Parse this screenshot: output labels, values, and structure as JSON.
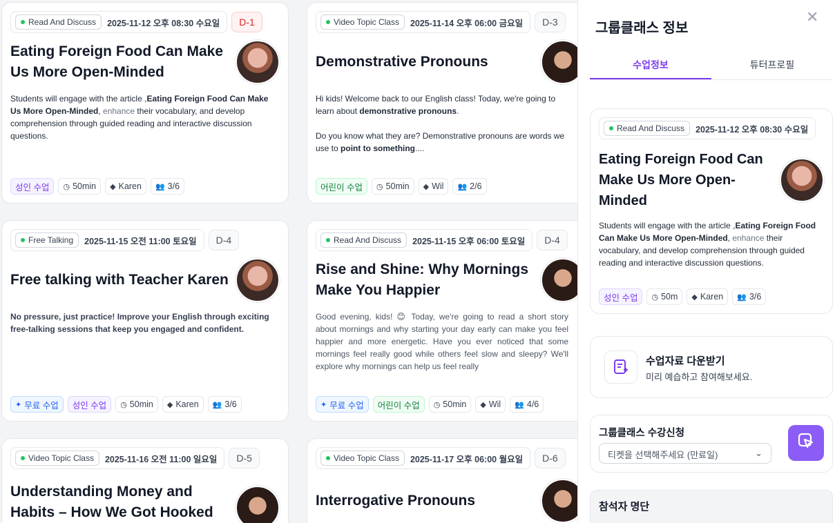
{
  "cards": [
    {
      "category": "Read And Discuss",
      "date": "2025-11-12 오후 08:30 수요일",
      "dday": "D-1",
      "title": "Eating Foreign Food Can Make Us More Open-Minded",
      "desc_1": "Students will engage with the article ,",
      "desc_bold": "Eating Foreign Food Can Make Us More Open-Minded",
      "desc_2": ", ",
      "desc_muted": "enhance",
      "desc_3": " their vocabulary, and develop comprehension through guided reading and interactive discussion questions.",
      "tags": [
        {
          "label": "성인 수업",
          "kind": "adult"
        },
        {
          "label": "50min",
          "kind": "time"
        },
        {
          "label": "Karen",
          "kind": "tutor"
        },
        {
          "label": "3/6",
          "kind": "people"
        }
      ]
    },
    {
      "category": "Video Topic Class",
      "date": "2025-11-14 오후 06:00 금요일",
      "dday": "D-3",
      "title": "Demonstrative Pronouns",
      "desc_p1_a": "Hi kids! Welcome back to our English class! Today, we're going to learn about ",
      "desc_p1_b": "demonstrative pronouns",
      "desc_p1_c": ".",
      "desc_p2_a": "Do you know what they are? Demonstrative pronouns are words we use to ",
      "desc_p2_b": "point to something",
      "desc_p2_c": "....",
      "tags": [
        {
          "label": "어린이 수업",
          "kind": "kid"
        },
        {
          "label": "50min",
          "kind": "time"
        },
        {
          "label": "Wil",
          "kind": "tutor"
        },
        {
          "label": "2/6",
          "kind": "people"
        }
      ]
    },
    {
      "category": "Free Talking",
      "date": "2025-11-15 오전 11:00 토요일",
      "dday": "D-4",
      "title": "Free talking with Teacher Karen",
      "desc": "No pressure, just practice! Improve your English through exciting free-talking sessions that keep you engaged and confident.",
      "tags": [
        {
          "label": "무료 수업",
          "kind": "free"
        },
        {
          "label": "성인 수업",
          "kind": "adult"
        },
        {
          "label": "50min",
          "kind": "time"
        },
        {
          "label": "Karen",
          "kind": "tutor"
        },
        {
          "label": "3/6",
          "kind": "people"
        }
      ]
    },
    {
      "category": "Read And Discuss",
      "date": "2025-11-15 오후 06:00 토요일",
      "dday": "D-4",
      "title": "Rise and Shine: Why Mornings Make You Happier",
      "desc": "Good evening, kids! 😊 Today, we're going to read a short story about mornings and why starting your day early can make you feel happier and more energetic. Have you ever noticed that some mornings feel really good while others feel slow and sleepy? We'll explore why mornings can help us feel really",
      "tags": [
        {
          "label": "무료 수업",
          "kind": "free"
        },
        {
          "label": "어린이 수업",
          "kind": "kid"
        },
        {
          "label": "50min",
          "kind": "time"
        },
        {
          "label": "Wil",
          "kind": "tutor"
        },
        {
          "label": "4/6",
          "kind": "people"
        }
      ]
    },
    {
      "category": "Video Topic Class",
      "date": "2025-11-16 오전 11:00 일요일",
      "dday": "D-5",
      "title": "Understanding Money and Habits – How We Got Hooked on Credit"
    },
    {
      "category": "Video Topic Class",
      "date": "2025-11-17 오후 06:00 월요일",
      "dday": "D-6",
      "title": "Interrogative Pronouns"
    }
  ],
  "panel": {
    "title": "그룹클래스 정보",
    "tabs": [
      "수업정보",
      "튜터프로필"
    ],
    "detail": {
      "category": "Read And Discuss",
      "date": "2025-11-12 오후 08:30 수요일",
      "title": "Eating Foreign Food Can Make Us More Open-Minded",
      "desc_1": "Students will engage with the article ,",
      "desc_bold": "Eating Foreign Food Can Make Us More Open-Minded",
      "desc_2": ", ",
      "desc_muted": "enhance",
      "desc_3": " their vocabulary, and develop comprehension through guided reading and interactive discussion questions.",
      "tags": [
        {
          "label": "성인 수업",
          "kind": "adult"
        },
        {
          "label": "50m",
          "kind": "time"
        },
        {
          "label": "Karen",
          "kind": "tutor"
        },
        {
          "label": "3/6",
          "kind": "people"
        }
      ]
    },
    "download": {
      "title": "수업자료 다운받기",
      "subtitle": "미리 예습하고 참여해보세요."
    },
    "enroll": {
      "title": "그룹클래스 수강신청",
      "placeholder": "티켓을 선택해주세요 (만료일)"
    },
    "participants_title": "참석자 명단"
  },
  "colors": {
    "accent": "#7c3aed",
    "button": "#8b5cf6",
    "urgent": "#dc2626"
  }
}
